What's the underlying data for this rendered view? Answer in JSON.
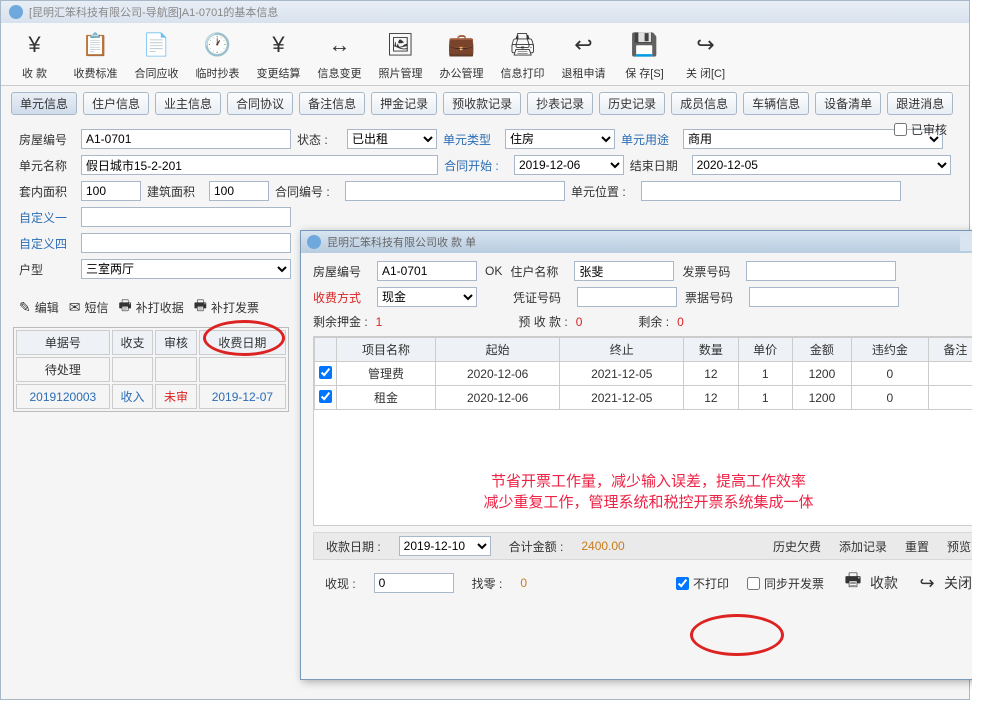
{
  "main": {
    "title": "[昆明汇笨科技有限公司-导航图]A1-0701的基本信息",
    "toolbar": [
      {
        "label": "收  款",
        "icon": "¥"
      },
      {
        "label": "收费标准",
        "icon": "📋"
      },
      {
        "label": "合同应收",
        "icon": "📄"
      },
      {
        "label": "临时抄表",
        "icon": "🕐"
      },
      {
        "label": "变更结算",
        "icon": "¥"
      },
      {
        "label": "信息变更",
        "icon": "↔"
      },
      {
        "label": "照片管理",
        "icon": "🖼"
      },
      {
        "label": "办公管理",
        "icon": "💼"
      },
      {
        "label": "信息打印",
        "icon": "🖨"
      },
      {
        "label": "退租申请",
        "icon": "↩"
      },
      {
        "label": "保 存[S]",
        "icon": "💾"
      },
      {
        "label": "关 闭[C]",
        "icon": "↪"
      }
    ],
    "tabs": [
      "单元信息",
      "住户信息",
      "业主信息",
      "合同协议",
      "备注信息",
      "押金记录",
      "预收款记录",
      "抄表记录",
      "历史记录",
      "成员信息",
      "车辆信息",
      "设备清单",
      "跟进消息"
    ],
    "reviewed_label": "已审核",
    "form": {
      "house_code_label": "房屋编号",
      "house_code": "A1-0701",
      "status_label": "状态 :",
      "status": "已出租",
      "unit_type_label": "单元类型",
      "unit_type": "住房",
      "unit_purpose_label": "单元用途",
      "unit_purpose": "商用",
      "unit_name_label": "单元名称",
      "unit_name": "假日城市15-2-201",
      "contract_start_label": "合同开始 :",
      "contract_start": "2019-12-06",
      "end_date_label": "结束日期",
      "end_date": "2020-12-05",
      "suite_area_label": "套内面积",
      "suite_area": "100",
      "build_area_label": "建筑面积",
      "build_area": "100",
      "contract_no_label": "合同编号 :",
      "contract_no": "",
      "unit_pos_label": "单元位置 :",
      "unit_pos": "",
      "custom1_label": "自定义一",
      "custom4_label": "自定义四",
      "house_type_label": "户型",
      "house_type": "三室两厅"
    },
    "actions": {
      "edit": "编辑",
      "sms": "短信",
      "reprint_receipt": "补打收据",
      "reprint_invoice": "补打发票"
    },
    "table": {
      "headers": [
        "单据号",
        "收支",
        "审核",
        "收费日期"
      ],
      "rows": [
        {
          "id": "待处理",
          "io": "",
          "audit": "",
          "date": ""
        },
        {
          "id": "2019120003",
          "io": "收入",
          "audit": "未审",
          "date": "2019-12-07"
        }
      ]
    }
  },
  "popup": {
    "title": "昆明汇笨科技有限公司收  款  单",
    "form": {
      "house_code_label": "房屋编号",
      "house_code": "A1-0701",
      "ok": "OK",
      "resident_label": "住户名称",
      "resident": "张斐",
      "invoice_no_label": "发票号码",
      "invoice_no": "",
      "pay_method_label": "收费方式",
      "pay_method": "现金",
      "voucher_label": "凭证号码",
      "voucher": "",
      "bill_no_label": "票据号码",
      "bill_no": "",
      "deposit_left_label": "剩余押金 :",
      "deposit_left": "1",
      "prepay_label": "预 收 款 :",
      "prepay": "0",
      "remain_label": "剩余 :",
      "remain": "0"
    },
    "grid": {
      "headers": [
        "",
        "项目名称",
        "起始",
        "终止",
        "数量",
        "单价",
        "金额",
        "违约金",
        "备注"
      ],
      "rows": [
        {
          "chk": true,
          "name": "管理费",
          "start": "2020-12-06",
          "end": "2021-12-05",
          "qty": "12",
          "price": "1",
          "amount": "1200",
          "penalty": "0",
          "note": ""
        },
        {
          "chk": true,
          "name": "租金",
          "start": "2020-12-06",
          "end": "2021-12-05",
          "qty": "12",
          "price": "1",
          "amount": "1200",
          "penalty": "0",
          "note": ""
        }
      ]
    },
    "note": {
      "line1": "节省开票工作量，减少输入误差，提高工作效率",
      "line2": "减少重复工作，管理系统和税控开票系统集成一体"
    },
    "strip": {
      "date_label": "收款日期 :",
      "date": "2019-12-10",
      "total_label": "合计金额 :",
      "total": "2400.00",
      "history": "历史欠费",
      "add": "添加记录",
      "reset": "重置",
      "preview": "预览"
    },
    "bottom": {
      "received_label": "收现 :",
      "received": "0",
      "change_label": "找零 :",
      "change": "0",
      "noprint": "不打印",
      "sync_invoice": "同步开发票",
      "pay": "收款",
      "close": "关闭"
    }
  }
}
